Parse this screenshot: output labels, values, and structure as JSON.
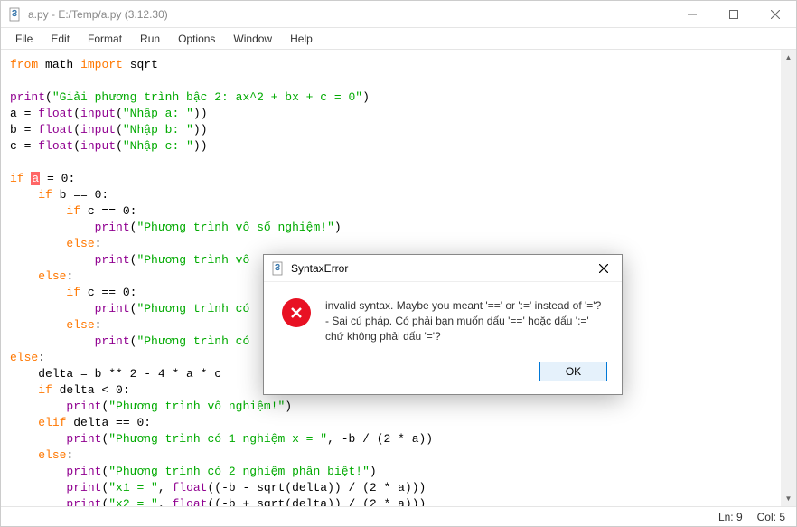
{
  "window": {
    "title": "a.py - E:/Temp/a.py (3.12.30)"
  },
  "menu": {
    "items": [
      "File",
      "Edit",
      "Format",
      "Run",
      "Options",
      "Window",
      "Help"
    ]
  },
  "code": {
    "l1_kw1": "from",
    "l1_mod": "math",
    "l1_kw2": "import",
    "l1_name": "sqrt",
    "l3_fn": "print",
    "l3_op1": "(",
    "l3_str": "\"Giải phương trình bậc 2: ax^2 + bx + c = 0\"",
    "l3_op2": ")",
    "l4_a": "a = ",
    "l4_fn1": "float",
    "l4_op1": "(",
    "l4_fn2": "input",
    "l4_op2": "(",
    "l4_str": "\"Nhập a: \"",
    "l4_op3": "))",
    "l5_a": "b = ",
    "l5_fn1": "float",
    "l5_op1": "(",
    "l5_fn2": "input",
    "l5_op2": "(",
    "l5_str": "\"Nhập b: \"",
    "l5_op3": "))",
    "l6_a": "c = ",
    "l6_fn1": "float",
    "l6_op1": "(",
    "l6_fn2": "input",
    "l6_op2": "(",
    "l6_str": "\"Nhập c: \"",
    "l6_op3": "))",
    "l8_kw": "if",
    "l8_sp": " ",
    "l8_hl": "a",
    "l8_rest": " = 0:",
    "l9_ind": "    ",
    "l9_kw": "if",
    "l9_rest": " b == 0:",
    "l10_ind": "        ",
    "l10_kw": "if",
    "l10_rest": " c == 0:",
    "l11_ind": "            ",
    "l11_fn": "print",
    "l11_op1": "(",
    "l11_str": "\"Phương trình vô số nghiệm!\"",
    "l11_op2": ")",
    "l12_ind": "        ",
    "l12_kw": "else",
    "l12_colon": ":",
    "l13_ind": "            ",
    "l13_fn": "print",
    "l13_op1": "(",
    "l13_str": "\"Phương trình vô",
    "l14_ind": "    ",
    "l14_kw": "else",
    "l14_colon": ":",
    "l15_ind": "        ",
    "l15_kw": "if",
    "l15_rest": " c == 0:",
    "l16_ind": "            ",
    "l16_fn": "print",
    "l16_op1": "(",
    "l16_str": "\"Phương trình có",
    "l17_ind": "        ",
    "l17_kw": "else",
    "l17_colon": ":",
    "l18_ind": "            ",
    "l18_fn": "print",
    "l18_op1": "(",
    "l18_str": "\"Phương trình có",
    "l19_kw": "else",
    "l19_colon": ":",
    "l20_ind": "    ",
    "l20_rest": "delta = b ** 2 - 4 * a * c",
    "l21_ind": "    ",
    "l21_kw": "if",
    "l21_rest": " delta < 0:",
    "l22_ind": "        ",
    "l22_fn": "print",
    "l22_op1": "(",
    "l22_str": "\"Phương trình vô nghiệm!\"",
    "l22_op2": ")",
    "l23_ind": "    ",
    "l23_kw": "elif",
    "l23_rest": " delta == 0:",
    "l24_ind": "        ",
    "l24_fn": "print",
    "l24_op1": "(",
    "l24_str": "\"Phương trình có 1 nghiệm x = \"",
    "l24_rest": ", -b / (2 * a))",
    "l25_ind": "    ",
    "l25_kw": "else",
    "l25_colon": ":",
    "l26_ind": "        ",
    "l26_fn": "print",
    "l26_op1": "(",
    "l26_str": "\"Phương trình có 2 nghiệm phân biệt!\"",
    "l26_op2": ")",
    "l27_ind": "        ",
    "l27_fn": "print",
    "l27_op1": "(",
    "l27_str": "\"x1 = \"",
    "l27_mid": ", ",
    "l27_fn2": "float",
    "l27_rest": "((-b - sqrt(delta)) / (2 * a)))",
    "l28_ind": "        ",
    "l28_fn": "print",
    "l28_op1": "(",
    "l28_str": "\"x2 = \"",
    "l28_mid": ", ",
    "l28_fn2": "float",
    "l28_rest": "((-b + sqrt(delta)) / (2 * a)))"
  },
  "status": {
    "line": "Ln: 9",
    "col": "Col: 5"
  },
  "dialog": {
    "title": "SyntaxError",
    "message": "invalid syntax. Maybe you meant '==' or ':=' instead of '='? - Sai cú pháp. Có phải bạn muốn dấu '==' hoặc dấu ':=' chứ không phải dấu '='?",
    "ok_label": "OK"
  }
}
